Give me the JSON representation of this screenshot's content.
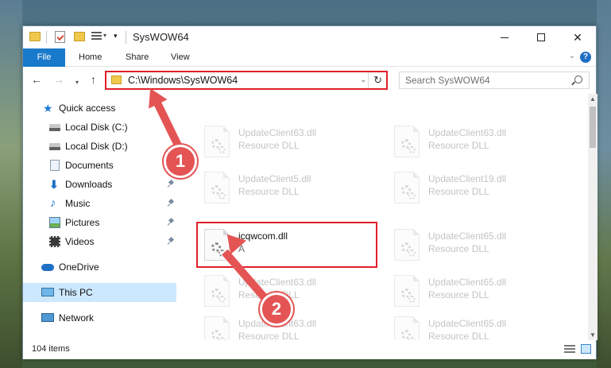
{
  "window": {
    "title": "SysWOW64",
    "minimize_label": "",
    "close_glyph": "✕"
  },
  "ribbon": {
    "tabs": [
      {
        "label": "File",
        "active": true
      },
      {
        "label": "Home"
      },
      {
        "label": "Share"
      },
      {
        "label": "View"
      }
    ],
    "help": "?"
  },
  "nav": {
    "address": "C:\\Windows\\SysWOW64",
    "search_placeholder": "Search SysWOW64"
  },
  "sidebar": {
    "items": [
      {
        "label": "Quick access",
        "icon": "star-icon"
      },
      {
        "label": "Local Disk (C:)",
        "icon": "drive-icon"
      },
      {
        "label": "Local Disk (D:)",
        "icon": "drive-icon"
      },
      {
        "label": "Documents",
        "icon": "documents-icon",
        "pinned": true
      },
      {
        "label": "Downloads",
        "icon": "downloads-icon",
        "pinned": true
      },
      {
        "label": "Music",
        "icon": "music-icon",
        "pinned": true
      },
      {
        "label": "Pictures",
        "icon": "pictures-icon",
        "pinned": true
      },
      {
        "label": "Videos",
        "icon": "videos-icon",
        "pinned": true
      },
      {
        "label": "OneDrive",
        "icon": "onedrive-icon"
      },
      {
        "label": "This PC",
        "icon": "this-pc-icon",
        "selected": true
      },
      {
        "label": "Network",
        "icon": "network-icon"
      }
    ]
  },
  "files": [
    {
      "name": "UpdateClient63.dll",
      "type": "Resource DLL",
      "faded": true
    },
    {
      "name": "UpdateClient63.dll",
      "type": "Resource DLL",
      "faded": true
    },
    {
      "name": "UpdateClient5.dll",
      "type": "Resource DLL",
      "faded": true
    },
    {
      "name": "UpdateClient19.dll",
      "type": "Resource DLL",
      "faded": true
    },
    {
      "name": "icqwcom.dll",
      "type": "A",
      "faded": false
    },
    {
      "name": "UpdateClient65.dll",
      "type": "Resource DLL",
      "faded": true
    },
    {
      "name": "UpdateClient63.dll",
      "type": "Resource DLL",
      "faded": true
    },
    {
      "name": "UpdateClient65.dll",
      "type": "Resource DLL",
      "faded": true
    },
    {
      "name": "UpdateClient63.dll",
      "type": "Resource DLL",
      "faded": true
    },
    {
      "name": "UpdateClient65.dll",
      "type": "Resource DLL",
      "faded": true
    }
  ],
  "status": {
    "item_count": "104 items"
  },
  "annotations": {
    "step1": "1",
    "step2": "2",
    "color": "#e45454",
    "highlight_color": "#e0202a"
  }
}
